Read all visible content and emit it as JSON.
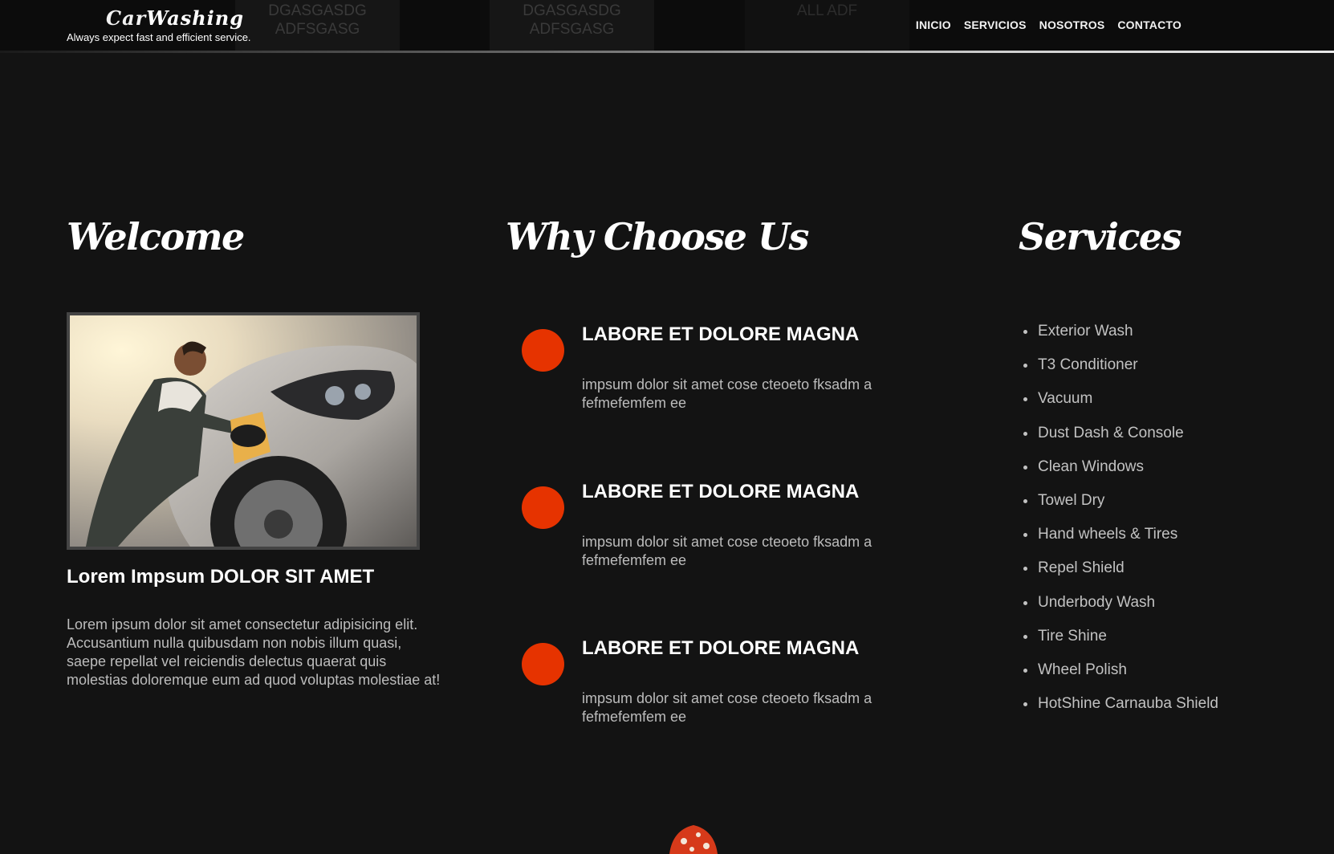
{
  "header": {
    "logo_title_a": "Car",
    "logo_title_b": "Washing",
    "logo_tagline": "Always expect fast and efficient service.",
    "ghost_blocks": [
      "DGASGASDG ADFSGASG",
      "DGASGASDG ADFSGASG",
      "ALL ADF"
    ],
    "nav": [
      "INICIO",
      "SERVICIOS",
      "NOSOTROS",
      "CONTACTO"
    ]
  },
  "welcome": {
    "title": "Welcome",
    "subtitle": "Lorem Impsum DOLOR SIT AMET",
    "text": "Lorem ipsum dolor sit amet consectetur adipisicing elit. Accusantium nulla quibusdam non nobis illum quasi, saepe repellat vel reiciendis delectus quaerat quis molestias doloremque eum ad quod voluptas molestiae at!"
  },
  "why": {
    "title": "Why Choose Us",
    "items": [
      {
        "title": "LABORE ET DOLORE MAGNA",
        "text": "impsum dolor sit amet cose cteoeto fksadm a fefmefemfem ee"
      },
      {
        "title": "LABORE ET DOLORE MAGNA",
        "text": "impsum dolor sit amet cose cteoeto fksadm a fefmefemfem ee"
      },
      {
        "title": "LABORE ET DOLORE MAGNA",
        "text": "impsum dolor sit amet cose cteoeto fksadm a fefmefemfem ee"
      }
    ]
  },
  "services": {
    "title": "Services",
    "items": [
      "Exterior Wash",
      "T3 Conditioner",
      "Vacuum",
      "Dust Dash & Console",
      "Clean Windows",
      "Towel Dry",
      "Hand wheels & Tires",
      "Repel Shield",
      "Underbody Wash",
      "Tire Shine",
      "Wheel Polish",
      "HotShine Carnauba Shield"
    ]
  },
  "colors": {
    "background": "#131313",
    "accent_dot": "#e63300",
    "muted_text": "#bcbcbc"
  }
}
